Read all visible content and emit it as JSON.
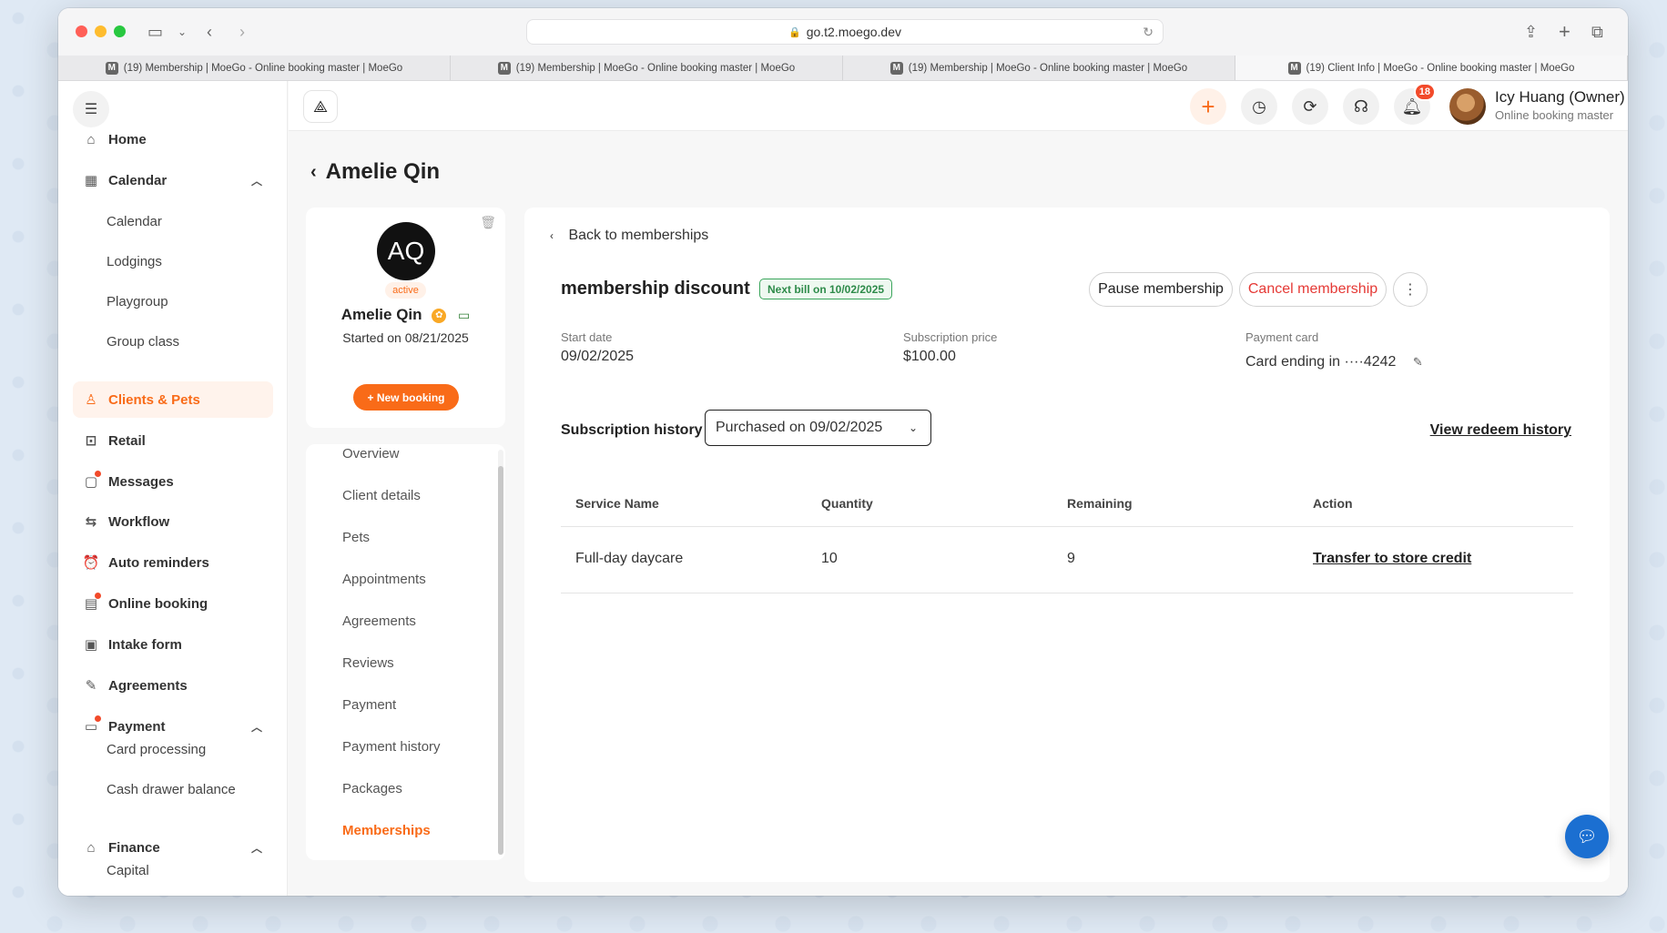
{
  "browser": {
    "url": "go.t2.moego.dev",
    "tabs": [
      {
        "label": "(19) Membership | MoeGo - Online booking master | MoeGo",
        "active": false
      },
      {
        "label": "(19) Membership | MoeGo - Online booking master | MoeGo",
        "active": false
      },
      {
        "label": "(19) Membership | MoeGo - Online booking master | MoeGo",
        "active": false
      },
      {
        "label": "(19) Client Info | MoeGo - Online booking master | MoeGo",
        "active": true
      }
    ],
    "favicon_letter": "M"
  },
  "sidebar": {
    "items": [
      {
        "label": "Home",
        "icon": "home-icon"
      },
      {
        "label": "Calendar",
        "icon": "calendar-icon"
      },
      {
        "label": "Clients & Pets",
        "icon": "clients-icon"
      },
      {
        "label": "Retail",
        "icon": "retail-icon"
      },
      {
        "label": "Messages",
        "icon": "messages-icon"
      },
      {
        "label": "Workflow",
        "icon": "workflow-icon"
      },
      {
        "label": "Auto reminders",
        "icon": "reminder-icon"
      },
      {
        "label": "Online booking",
        "icon": "online-booking-icon"
      },
      {
        "label": "Intake form",
        "icon": "intake-form-icon"
      },
      {
        "label": "Agreements",
        "icon": "agreements-icon"
      },
      {
        "label": "Payment",
        "icon": "payment-icon"
      },
      {
        "label": "Finance",
        "icon": "finance-icon"
      }
    ],
    "calendar_sub": [
      "Calendar",
      "Lodgings",
      "Playgroup",
      "Group class"
    ],
    "payment_sub": [
      "Card processing",
      "Cash drawer balance"
    ],
    "finance_sub": [
      "Capital"
    ]
  },
  "header": {
    "notification_count": "18",
    "user_name": "Icy Huang (Owner)",
    "user_role": "Online booking master"
  },
  "page": {
    "title": "Amelie Qin"
  },
  "client": {
    "initials": "AQ",
    "status": "active",
    "name": "Amelie Qin",
    "started": "Started on 08/21/2025",
    "new_booking": "+ New booking"
  },
  "subnav": [
    "Overview",
    "Client details",
    "Pets",
    "Appointments",
    "Agreements",
    "Reviews",
    "Payment",
    "Payment history",
    "Packages",
    "Memberships"
  ],
  "membership": {
    "back_label": "Back to memberships",
    "name": "membership discount",
    "next_bill": "Next bill on 10/02/2025",
    "pause_label": "Pause membership",
    "cancel_label": "Cancel membership",
    "start_date_label": "Start date",
    "start_date": "09/02/2025",
    "price_label": "Subscription price",
    "price": "$100.00",
    "card_label": "Payment card",
    "card_value": "Card ending in ····4242",
    "history_label": "Subscription history",
    "history_selected": "Purchased on 09/02/2025",
    "redeem_link": "View redeem history",
    "table": {
      "headers": [
        "Service Name",
        "Quantity",
        "Remaining",
        "Action"
      ],
      "rows": [
        {
          "service": "Full-day daycare",
          "quantity": "10",
          "remaining": "9",
          "action": "Transfer to store credit"
        }
      ]
    }
  },
  "colors": {
    "accent": "#f96b18",
    "danger": "#e53935",
    "success": "#2e8b4a",
    "chat": "#1b6fd1"
  }
}
